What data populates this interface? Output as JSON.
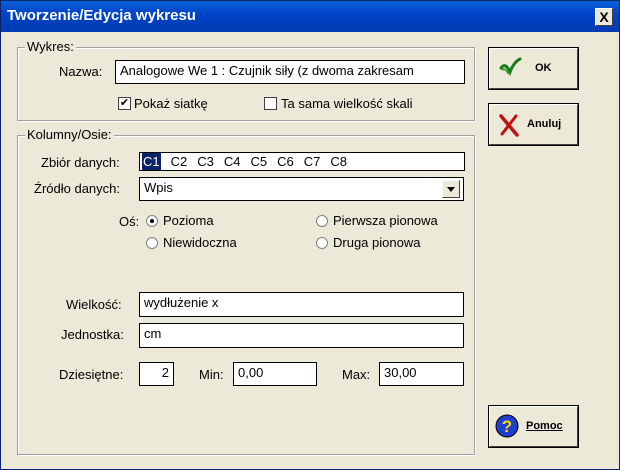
{
  "window": {
    "title": "Tworzenie/Edycja wykresu",
    "close_label": "X"
  },
  "wykres": {
    "group_label": "Wykres:",
    "nazwa_label": "Nazwa:",
    "nazwa_value": "Analogowe We 1 : Czujnik siły (z dwoma zakresam",
    "pokaz_siatke_label": "Pokaż siatkę",
    "pokaz_siatke_checked": "✔",
    "ta_sama_label": "Ta sama wielkość skali"
  },
  "kolumny": {
    "group_label": "Kolumny/Osie:",
    "zbior_label": "Zbiór danych:",
    "columns": [
      "C1",
      "C2",
      "C3",
      "C4",
      "C5",
      "C6",
      "C7",
      "C8"
    ],
    "zrodlo_label": "Źródło danych:",
    "zrodlo_value": "Wpis",
    "os_label": "Oś:",
    "os_options": {
      "pozioma": "Pozioma",
      "niewidoczna": "Niewidoczna",
      "pierwsza": "Pierwsza pionowa",
      "druga": "Druga pionowa"
    },
    "wielkosc_label": "Wielkość:",
    "wielkosc_value": "wydłużenie x",
    "jednostka_label": "Jednostka:",
    "jednostka_value": "cm",
    "dziesietne_label": "Dziesiętne:",
    "dziesietne_value": "2",
    "min_label": "Min:",
    "min_value": "0,00",
    "max_label": "Max:",
    "max_value": "30,00"
  },
  "buttons": {
    "ok": "OK",
    "anuluj": "Anuluj",
    "pomoc": "Pomoc"
  }
}
